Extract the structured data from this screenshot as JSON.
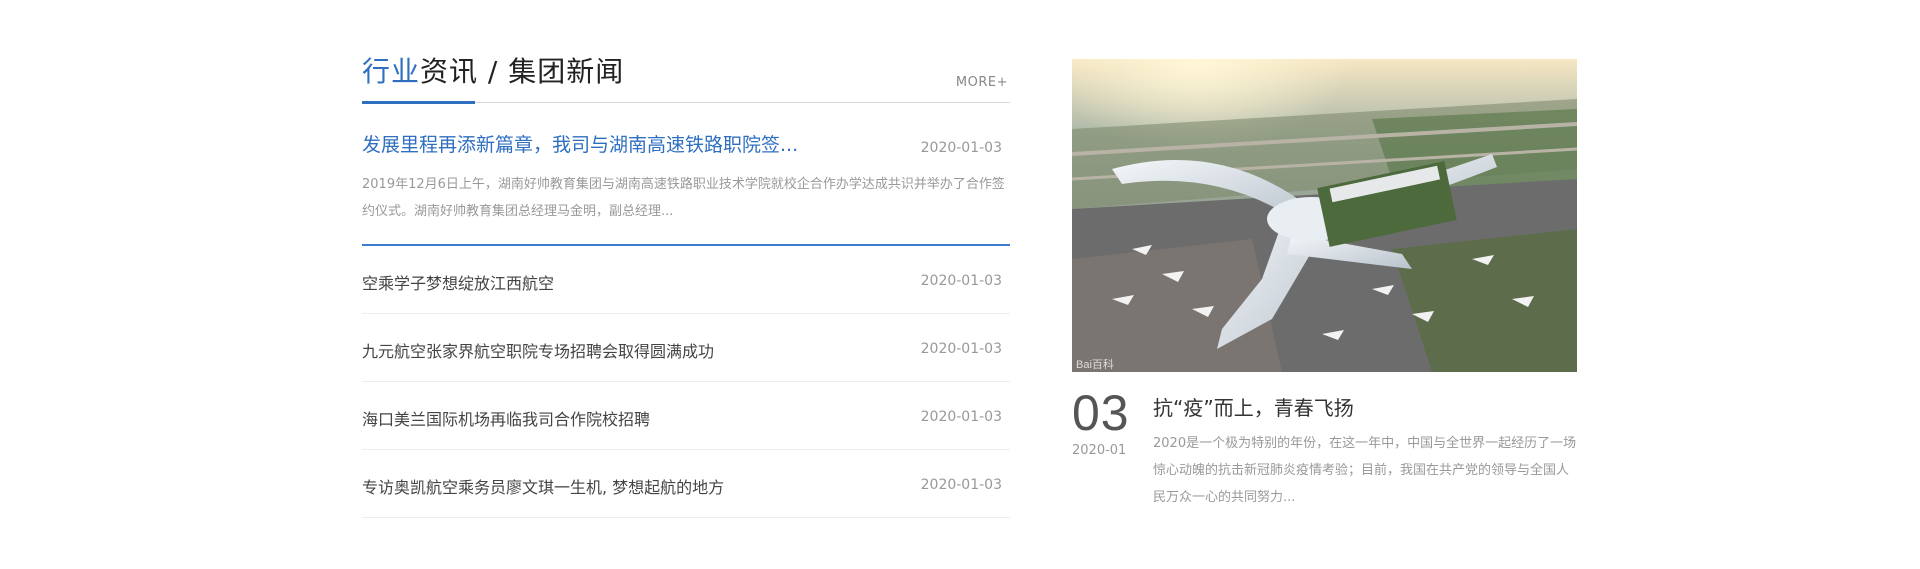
{
  "header": {
    "title_accent": "行业",
    "title_rest": "资讯 / 集团新闻",
    "more_label": "MORE+"
  },
  "featured": {
    "title": "发展里程再添新篇章，我司与湖南高速铁路职院签...",
    "date": "2020-01-03",
    "summary": "2019年12月6日上午，湖南好帅教育集团与湖南高速铁路职业技术学院就校企合作办学达成共识并举办了合作签约仪式。湖南好帅教育集团总经理马金明，副总经理..."
  },
  "news": [
    {
      "title": "空乘学子梦想绽放江西航空",
      "date": "2020-01-03"
    },
    {
      "title": "九元航空张家界航空职院专场招聘会取得圆满成功",
      "date": "2020-01-03"
    },
    {
      "title": "海口美兰国际机场再临我司合作院校招聘",
      "date": "2020-01-03"
    },
    {
      "title": "专访奥凯航空乘务员廖文琪一生机, 梦想起航的地方",
      "date": "2020-01-03"
    }
  ],
  "feature": {
    "day": "03",
    "year_month": "2020-01",
    "title": "抗“疫”而上，青春飞扬",
    "summary": "2020是一个极为特别的年份，在这一年中，中国与全世界一起经历了一场惊心动魄的抗击新冠肺炎疫情考验；目前，我国在共产党的领导与全国人民万众一心的共同努力...",
    "image_watermark": "Bai百科"
  },
  "colors": {
    "accent": "#2f6fc0",
    "text": "#444444",
    "muted": "#999999",
    "divider": "#ececec"
  }
}
